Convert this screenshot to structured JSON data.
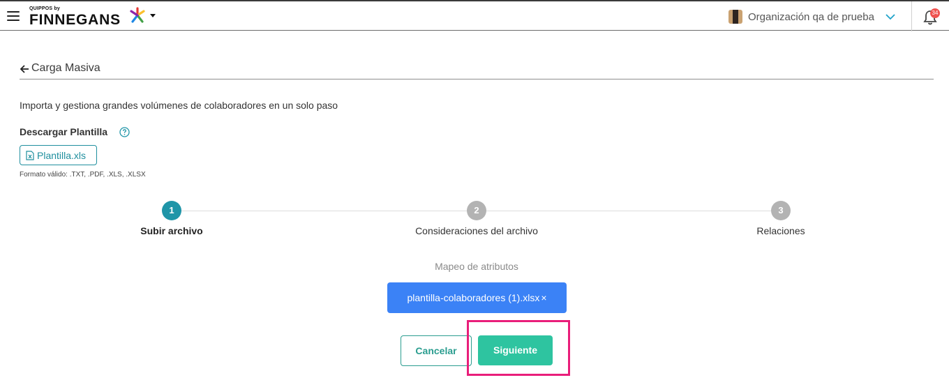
{
  "header": {
    "brand_small": "QUIPPOS by",
    "brand_name": "FINNEGANS",
    "org_name": "Organización qa de prueba",
    "notifications_count": "34",
    "icons": [
      "menu-icon",
      "brand-star-icon",
      "caret-down-icon",
      "org-avatar",
      "chevron-down-icon",
      "bell-icon"
    ]
  },
  "page": {
    "title": "Carga Masiva",
    "subtitle": "Importa y gestiona grandes volúmenes de colaboradores en un solo paso",
    "template_title": "Descargar Plantilla",
    "template_button": "Plantilla.xls",
    "format_note": "Formato válido: .TXT, .PDF, .XLS, .XLSX"
  },
  "stepper": {
    "steps": [
      {
        "number": "1",
        "label": "Subir archivo",
        "state": "active"
      },
      {
        "number": "2",
        "label": "Consideraciones del archivo",
        "state": "pending"
      },
      {
        "number": "3",
        "label": "Relaciones",
        "state": "pending"
      }
    ]
  },
  "upload": {
    "mapping_label": "Mapeo de atributos",
    "file_name": "plantilla-colaboradores (1).xlsx",
    "remove_glyph": "×"
  },
  "actions": {
    "cancel_label": "Cancelar",
    "next_label": "Siguiente"
  },
  "colors": {
    "primary_teal": "#1f95a8",
    "success_green": "#2ec4a0",
    "chip_blue": "#3b82f6",
    "highlight_pink": "#e91e7a",
    "badge_red": "#ef5350"
  }
}
